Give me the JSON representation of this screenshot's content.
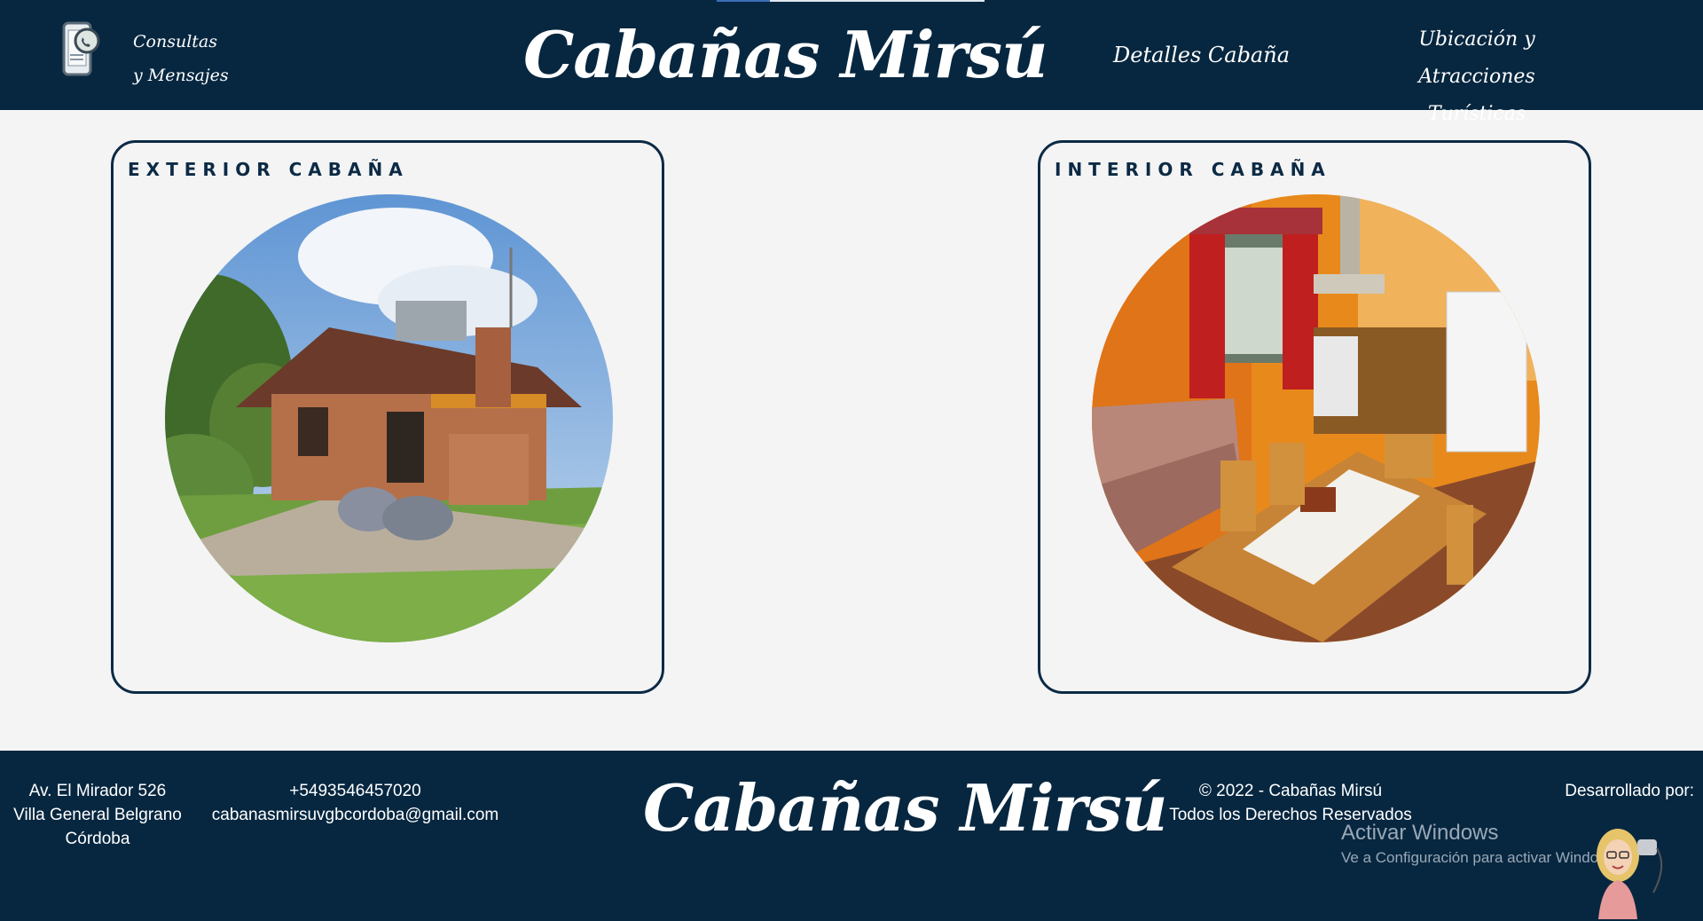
{
  "header": {
    "nav_consultas": "Consultas y Mensajes",
    "brand": "Cabañas Mirsú",
    "nav_detalles": "Detalles Cabaña",
    "nav_ubicacion": "Ubicación y Atracciones Turísticas",
    "icons": {
      "contact": "whatsapp-phone-icon"
    }
  },
  "cards": [
    {
      "title": "EXTERIOR CABAÑA",
      "image": "cabin-exterior-photo"
    },
    {
      "title": "INTERIOR CABAÑA",
      "image": "cabin-interior-photo"
    }
  ],
  "footer": {
    "address_line1": "Av. El Mirador 526",
    "address_line2": "Villa General Belgrano",
    "address_line3": "Córdoba",
    "phone": "+5493546457020",
    "email": "cabanasmirsuvgbcordoba@gmail.com",
    "brand": "Cabañas Mirsú",
    "copyright": "© 2022 - Cabañas Mirsú",
    "rights": "Todos los Derechos Reservados",
    "developed_by": "Desarrollado por:",
    "windows_title": "Activar Windows",
    "windows_sub": "Ve a Configuración para activar Windows."
  },
  "colors": {
    "navy": "#072740",
    "page_bg": "#f4f4f4",
    "card_border": "#0c2a45"
  }
}
